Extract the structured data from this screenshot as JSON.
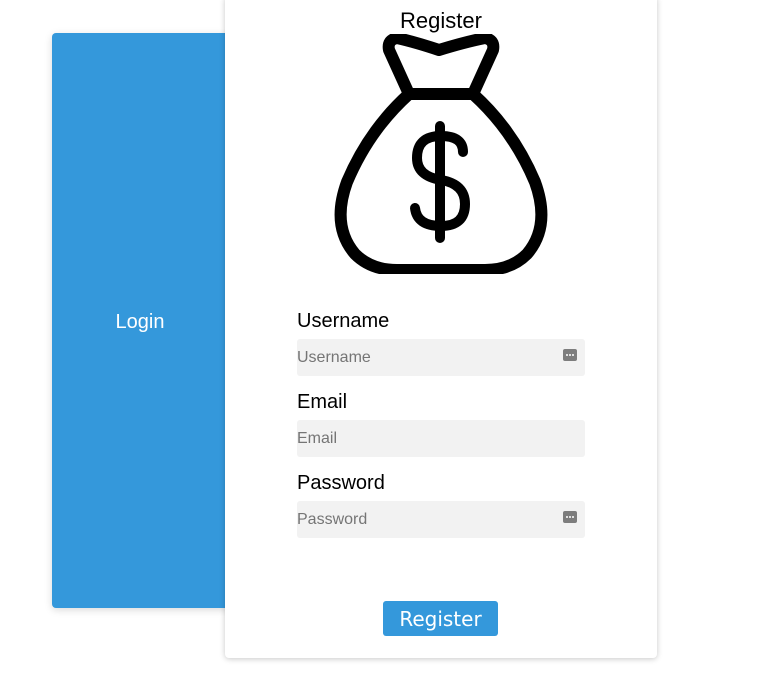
{
  "login_panel": {
    "label": "Login"
  },
  "register_form": {
    "title": "Register",
    "fields": [
      {
        "label": "Username",
        "placeholder": "Username",
        "value": ""
      },
      {
        "label": "Email",
        "placeholder": "Email",
        "value": ""
      },
      {
        "label": "Password",
        "placeholder": "Password",
        "value": ""
      }
    ],
    "submit_label": "Register",
    "icon": "money-bag-icon"
  },
  "colors": {
    "accent": "#3498db",
    "input_background": "#f2f2f2",
    "text": "#000000"
  }
}
